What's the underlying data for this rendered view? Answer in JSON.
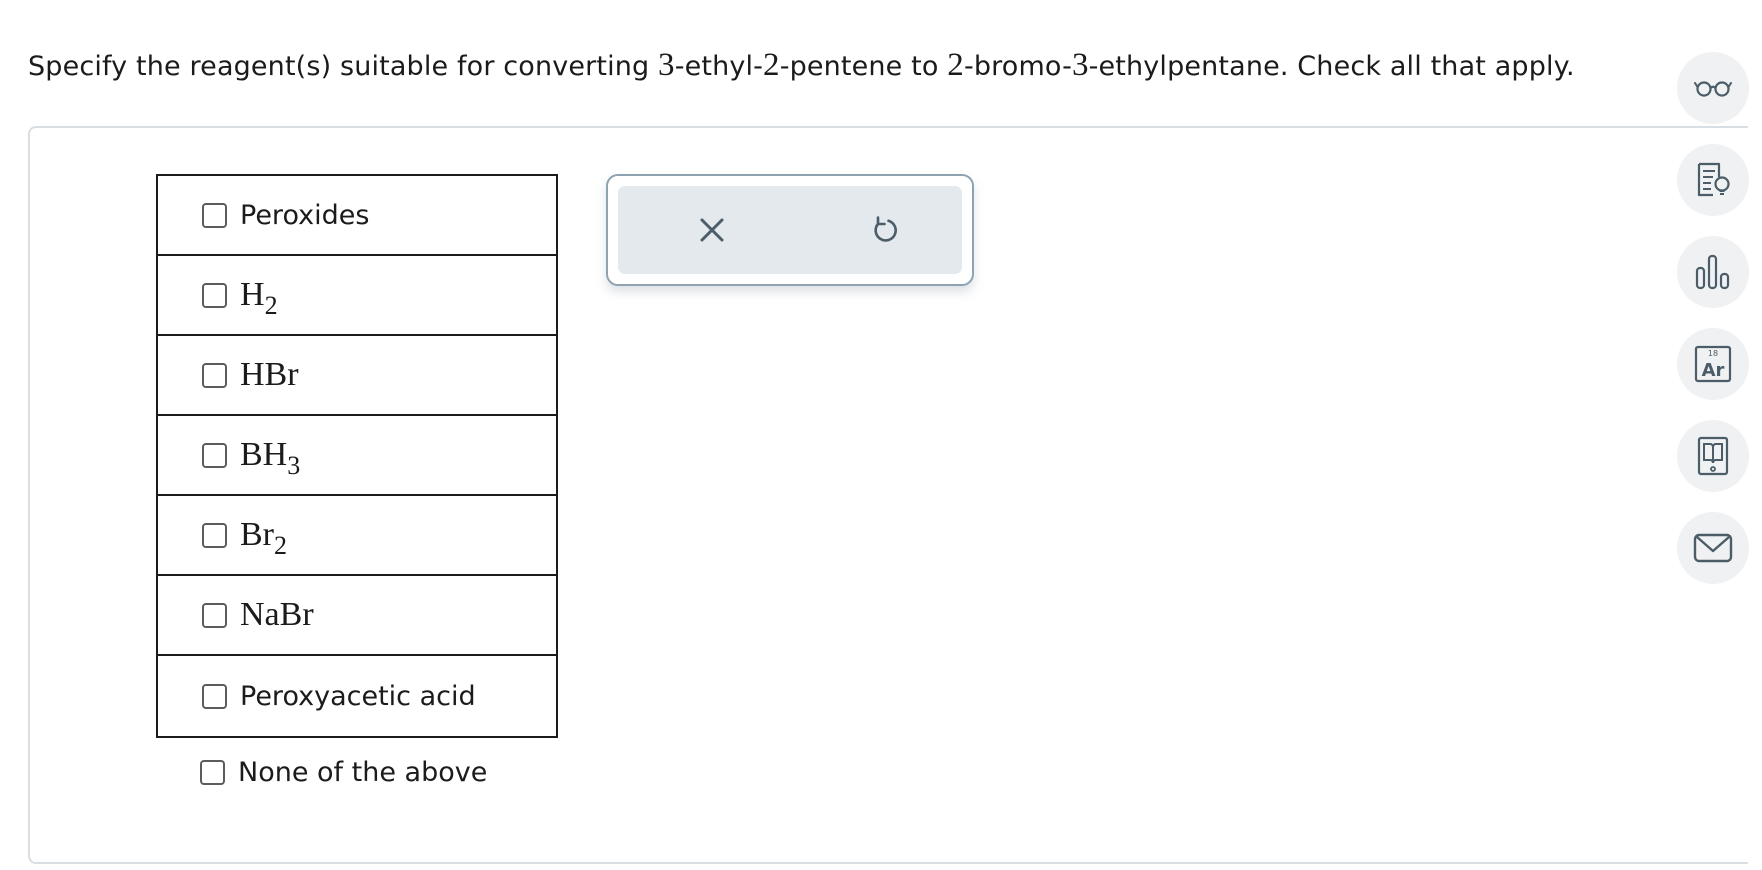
{
  "question": {
    "part1": "Specify the reagent(s) suitable for converting ",
    "num1": "3",
    "part2": "-ethyl-",
    "num2": "2",
    "part3": "-pentene to ",
    "num3": "2",
    "part4": "-bromo-",
    "num4": "3",
    "part5": "-ethylpentane. Check all that apply."
  },
  "options": [
    {
      "text": "Peroxides"
    },
    {
      "base": "H",
      "sub": "2"
    },
    {
      "base": "HBr",
      "sub": ""
    },
    {
      "base": "BH",
      "sub": "3"
    },
    {
      "base": "Br",
      "sub": "2"
    },
    {
      "base": "NaBr",
      "sub": ""
    },
    {
      "text": "Peroxyacetic acid"
    }
  ],
  "none_option": "None of the above",
  "actions": {
    "clear_icon": "close-icon",
    "undo_icon": "undo-icon"
  },
  "side_tools": {
    "icons": [
      "glasses-icon",
      "hint-icon",
      "chart-icon",
      "periodic-table-icon",
      "textbook-icon",
      "mail-icon"
    ],
    "periodic_number": "18",
    "periodic_symbol": "Ar"
  },
  "colors": {
    "icon": "#4b5d68",
    "tool_bg": "#eff1f2",
    "action_bg": "#e3e9ec",
    "panel_border": "#d9dee2"
  }
}
